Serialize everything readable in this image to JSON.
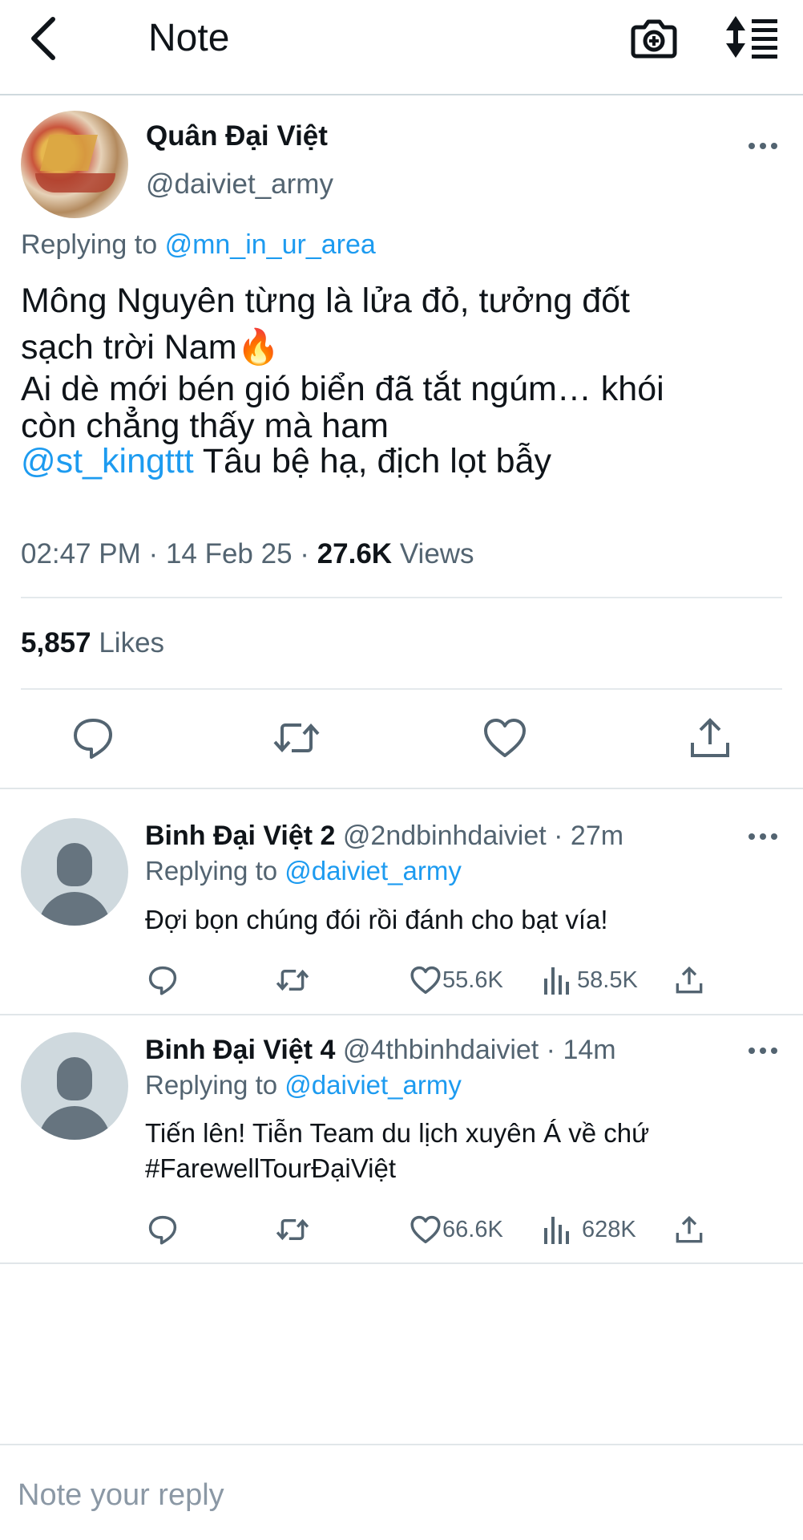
{
  "header": {
    "title": "Note",
    "back_icon": "chevron-left-icon",
    "camera_icon": "camera-plus-icon",
    "sort_icon": "sort-list-icon"
  },
  "tweet": {
    "author_name": "Quân Đại Việt",
    "author_handle": "@daiviet_army",
    "reply_prefix": "Replying to",
    "reply_to": "@mn_in_ur_area",
    "text_line1": "Mông Nguyên từng là lửa đỏ, tưởng đốt",
    "text_line2": "sạch trời Nam",
    "text_emoji": "🔥",
    "text_line3": "Ai dè mới bén gió biển đã tắt ngúm… khói",
    "text_line4": "còn chẳng thấy mà ham",
    "text_mention": "@st_kingttt",
    "text_line5_rest": " Tâu bệ hạ, địch lọt bẫy",
    "time": "02:47 PM",
    "date": "14 Feb 25",
    "views_count": "27.6K",
    "views_label": "Views",
    "likes_count": "5,857",
    "likes_label": "Likes",
    "more_icon": "more-dots-icon"
  },
  "replies": [
    {
      "name": "Binh Đại Việt 2",
      "handle": "@2ndbinhdaiviet",
      "time": "27m",
      "reply_prefix": "Replying to",
      "reply_to": "@daiviet_army",
      "text": "Đợi bọn chúng đói rồi đánh cho bạt vía!",
      "hashtag": "",
      "likes": "55.6K",
      "views": "58.5K"
    },
    {
      "name": "Binh Đại Việt 4",
      "handle": "@4thbinhdaiviet",
      "time": "14m",
      "reply_prefix": "Replying to",
      "reply_to": "@daiviet_army",
      "text": "Tiến lên! Tiễn Team du lịch xuyên Á về chứ",
      "hashtag": "#FarewellTourĐạiViệt",
      "likes": "66.6K",
      "views": "628K"
    }
  ],
  "reply_box": {
    "placeholder": "Note your reply"
  },
  "colors": {
    "accent": "#1d9bf0",
    "text": "#0f1419",
    "secondary": "#536471",
    "divider": "#e1e6e9"
  }
}
